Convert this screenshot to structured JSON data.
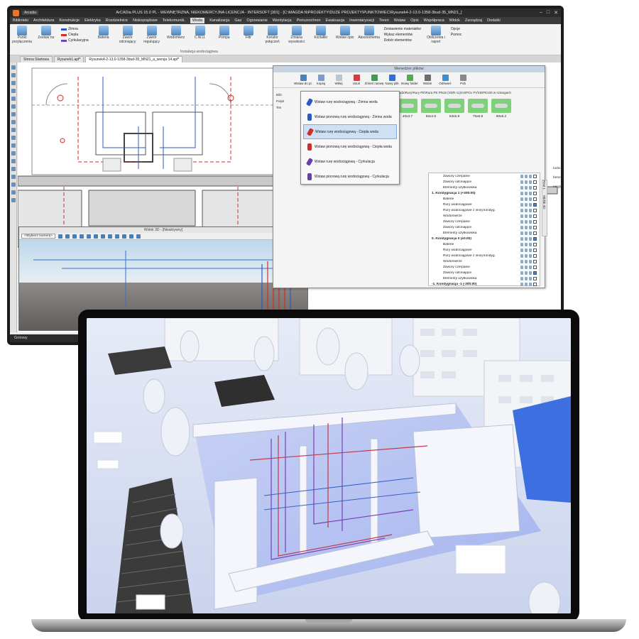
{
  "app": {
    "title": "ArCADia PLUS 15.0 PL - WEWNĘTRZNA, NIEKOMERCYJNA LICENCJA - INTERSOFT [301] - [C:\\MAGDA N\\PROJEKTY\\DUZE PROJEKTY\\PUNKTOWIEC\\Rysunek4-2-13.0-1358-3bud-35_MN21_]",
    "style_selector": "Arcadia",
    "menu": [
      "Biblioteki",
      "Architektura",
      "Konstrukcje",
      "Elektryka",
      "Rozdzielnice",
      "Niskoprądowe",
      "Telekomunik.",
      "Woda",
      "Kanalizacja",
      "Gaz",
      "Ogrzewanie",
      "Wentylacja",
      "Pionunochron",
      "Ewakuacja",
      "Inwentaryzacji",
      "Teren",
      "Wstaw",
      "Opis",
      "Współpraca",
      "Widok",
      "Zarządzaj",
      "Dodatki"
    ],
    "menu_active": "Woda",
    "ribbon": {
      "buttons": [
        {
          "label": "Punkt przyłączenia",
          "icon": "connection-point-icon"
        },
        {
          "label": "Zestaw rur",
          "icon": "pipe-set-icon"
        },
        {
          "label": "Bateria",
          "icon": "faucet-icon"
        },
        {
          "label": "Zawór odcinający",
          "icon": "shutoff-valve-icon"
        },
        {
          "label": "Zawór regulujący",
          "icon": "regulating-valve-icon"
        },
        {
          "label": "Wodomierz",
          "icon": "water-meter-icon"
        },
        {
          "label": "C.W.U.",
          "icon": "hot-water-icon"
        },
        {
          "label": "Pompa",
          "icon": "pump-icon"
        },
        {
          "label": "Filtr",
          "icon": "filter-icon"
        },
        {
          "label": "Kreator połączeń",
          "icon": "connection-wizard-icon"
        },
        {
          "label": "Zmiana wysokości",
          "icon": "height-change-icon"
        },
        {
          "label": "Kształtki",
          "icon": "fittings-icon"
        },
        {
          "label": "Wstaw opis",
          "icon": "insert-description-icon"
        },
        {
          "label": "Aksonometria",
          "icon": "axonometry-icon"
        }
      ],
      "pipe_types": [
        {
          "label": "Zimna",
          "color": "#2b59c3"
        },
        {
          "label": "Ciepła",
          "color": "#d12b2b"
        },
        {
          "label": "Cyrkulacyjna",
          "color": "#7b3fb8"
        }
      ],
      "reports": [
        "Zestawienie materiałów",
        "Wykaz elementów",
        "Dobór elementów"
      ],
      "calc": [
        "Obliczenia i raport"
      ],
      "help": [
        "Opcje",
        "Pomoc"
      ],
      "group_caption": "Instalacja wodociągowa"
    },
    "tabs": [
      "Strona Startowa",
      "Rysunek1.apf*",
      "Rysunek4-2-13.0-1358-3bud-35_MN21_a_wersja 14.apf*"
    ],
    "tab_active": 2,
    "status": "Gotowy"
  },
  "file_manager": {
    "title": "Menedżer plików",
    "tools": [
      "Wstaw do pr.",
      "Kopiuj",
      "Wklej",
      "Usuń",
      "Zmień nazwę",
      "Nowy plik",
      "Nowy folder",
      "Widok",
      "Odśwież",
      "Pob"
    ],
    "path": "...a15\\Global\\Woda\\Rury\\Rury PE\\Rura PE PN16 (SDR-11)\\ASPOL-FV\\HDPE100 w sztangach",
    "tree": [
      "Bibl.",
      "Pulpit",
      "Ten"
    ],
    "thumbnails": [
      "32x3",
      "40x3.7",
      "50x4.6",
      "63x5.8",
      "75x6.8",
      "90x8.2"
    ]
  },
  "dropdown": {
    "items": [
      {
        "label": "Wstaw rurę wodociągową - Zimna woda",
        "color": "#2b59c3",
        "vertical": false
      },
      {
        "label": "Wstaw pionową rurę wodociągową - Zimna woda",
        "color": "#2b59c3",
        "vertical": true
      },
      {
        "label": "Wstaw rurę wodociągową - Ciepła woda",
        "color": "#d12b2b",
        "vertical": false
      },
      {
        "label": "Wstaw pionową rurę wodociągową - Ciepła woda",
        "color": "#d12b2b",
        "vertical": true
      },
      {
        "label": "Wstaw rurę wodociągową - Cyrkulacja",
        "color": "#6b3fa8",
        "vertical": false
      },
      {
        "label": "Wstaw pionową rurę wodociągową - Cyrkulacja",
        "color": "#6b3fa8",
        "vertical": true
      }
    ],
    "selected_index": 2
  },
  "layers": {
    "rows": [
      {
        "label": "Zawory czerpalne",
        "indent": 2
      },
      {
        "label": "Zawory odcinające",
        "indent": 2
      },
      {
        "label": "Elementy użytkownika",
        "indent": 2
      },
      {
        "label": "1. Kondygnacja 1 (+300.00)",
        "indent": 0
      },
      {
        "label": "Baterie",
        "indent": 2
      },
      {
        "label": "Rury wodociągowe",
        "indent": 2
      },
      {
        "label": "Rury wodociągowe z innej kondyg.",
        "indent": 2
      },
      {
        "label": "Wodomierze",
        "indent": 2
      },
      {
        "label": "Zawory czerpalne",
        "indent": 2
      },
      {
        "label": "Zawory odcinające",
        "indent": 2
      },
      {
        "label": "Elementy użytkownika",
        "indent": 2
      },
      {
        "label": "0. Kondygnacja 0 (±0.00)",
        "indent": 0
      },
      {
        "label": "Baterie",
        "indent": 2
      },
      {
        "label": "Rury wodociągowe",
        "indent": 2
      },
      {
        "label": "Rury wodociągowe z innej kondyg.",
        "indent": 2
      },
      {
        "label": "Wodomierze",
        "indent": 2
      },
      {
        "label": "Zawory czerpalne",
        "indent": 2
      },
      {
        "label": "Zawory odcinające",
        "indent": 2
      },
      {
        "label": "Elementy użytkownika",
        "indent": 2
      },
      {
        "label": "-1. Kondygnacja -1 (-300.00)",
        "indent": 0
      }
    ],
    "side_labels": [
      "Rzut 1",
      "Widok 3D"
    ],
    "extra_labels": [
      "tudni beton...",
      "racyjne)"
    ]
  },
  "view3d": {
    "title": "Widok 3D - [Nieaktywny]",
    "camera_select": "<Wybierz kamerę>"
  }
}
